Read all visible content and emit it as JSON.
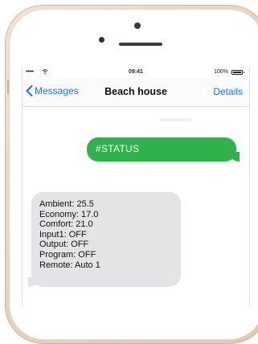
{
  "status_bar": {
    "signal": "•••••",
    "time": "09:41",
    "battery": "100%"
  },
  "nav": {
    "back_label": "Messages",
    "title": "Beach house",
    "details_label": "Details"
  },
  "conversation": {
    "sent_message": "#STATUS",
    "reply_lines": [
      "Ambient: 25.5",
      "Economy: 17.0",
      "Comfort: 21.0",
      "Input1: OFF",
      "Output: OFF",
      "Program: OFF",
      "Remote: Auto 1"
    ]
  },
  "colors": {
    "sent_bubble": "#2fb24c",
    "received_bubble": "#e4e4e6",
    "link_blue": "#1a73e8",
    "phone_body": "#e9d5c2"
  }
}
